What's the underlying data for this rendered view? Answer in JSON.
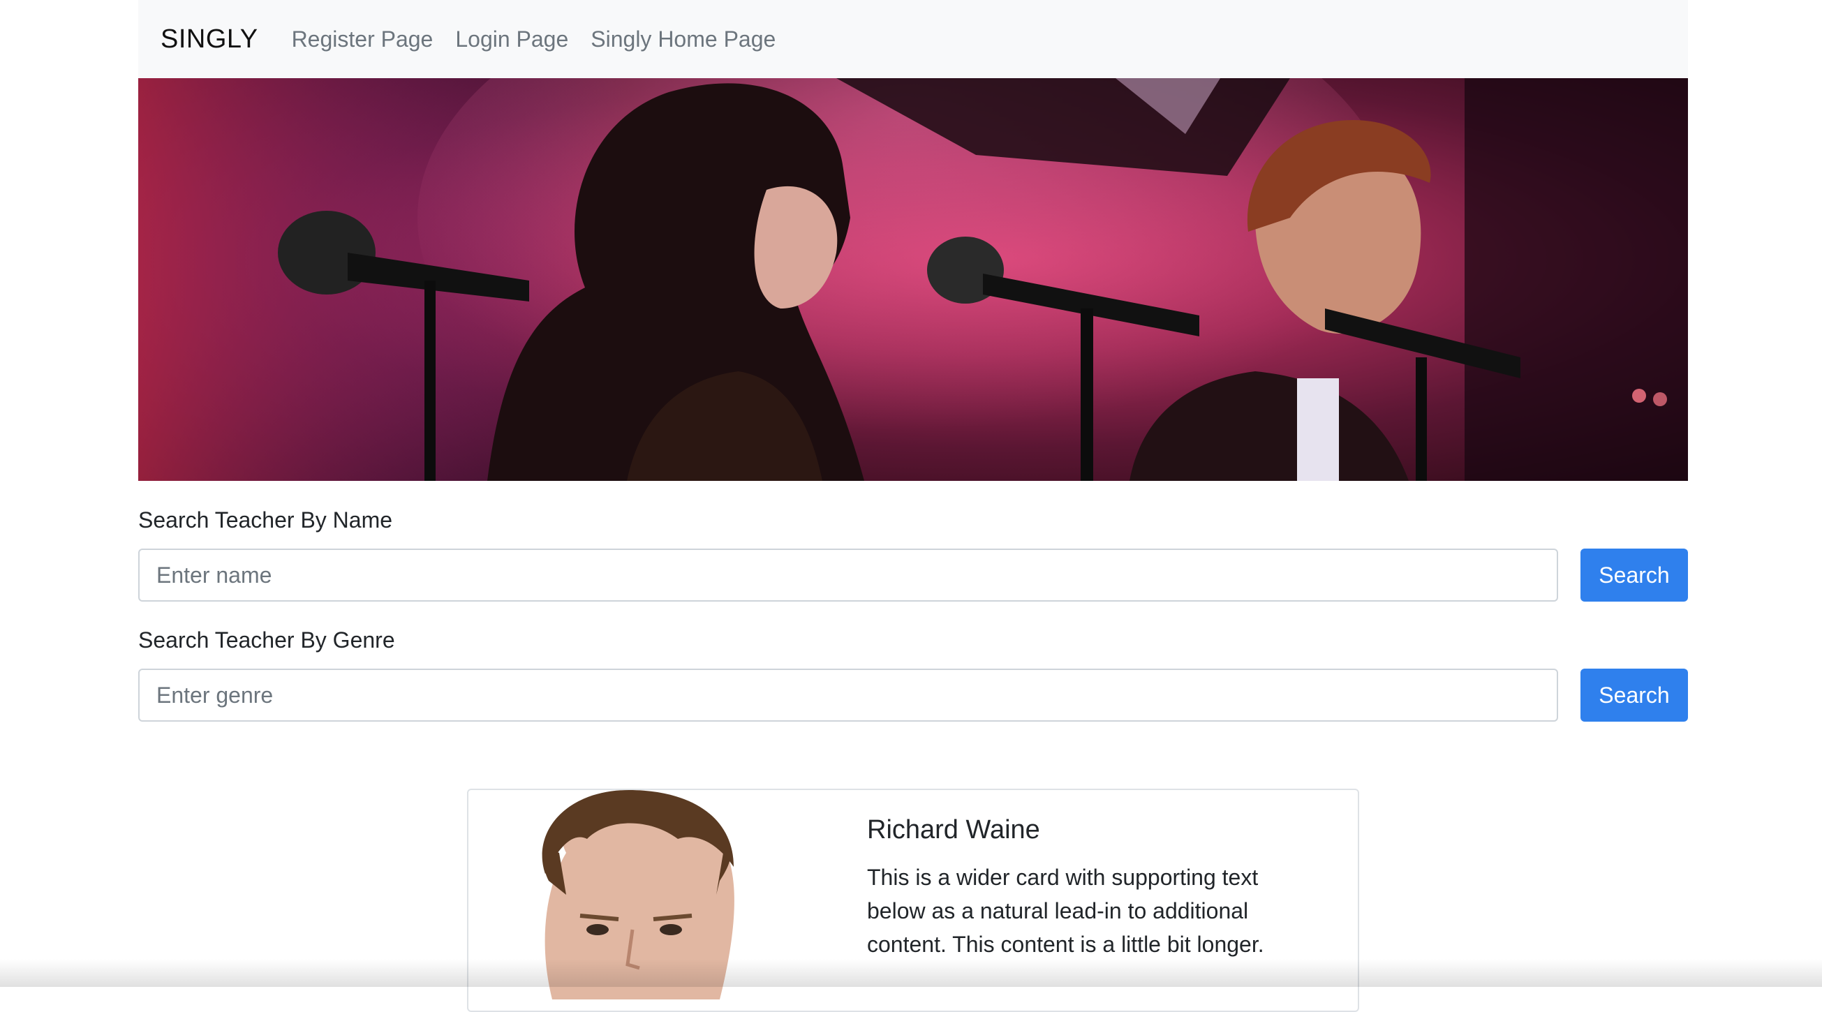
{
  "navbar": {
    "brand": "SINGLY",
    "links": [
      "Register Page",
      "Login Page",
      "Singly Home Page"
    ]
  },
  "hero": {
    "image_description": "singers-at-microphones"
  },
  "search_name": {
    "label": "Search Teacher By Name",
    "placeholder": "Enter name",
    "button": "Search"
  },
  "search_genre": {
    "label": "Search Teacher By Genre",
    "placeholder": "Enter genre",
    "button": "Search"
  },
  "card": {
    "name": "Richard Waine",
    "text": "This is a wider card with supporting text below as a natural lead-in to additional content. This content is a little bit longer."
  },
  "colors": {
    "navbar_bg": "#f8f9fa",
    "primary_button": "#2f80ed",
    "nav_link": "#6c757d"
  }
}
